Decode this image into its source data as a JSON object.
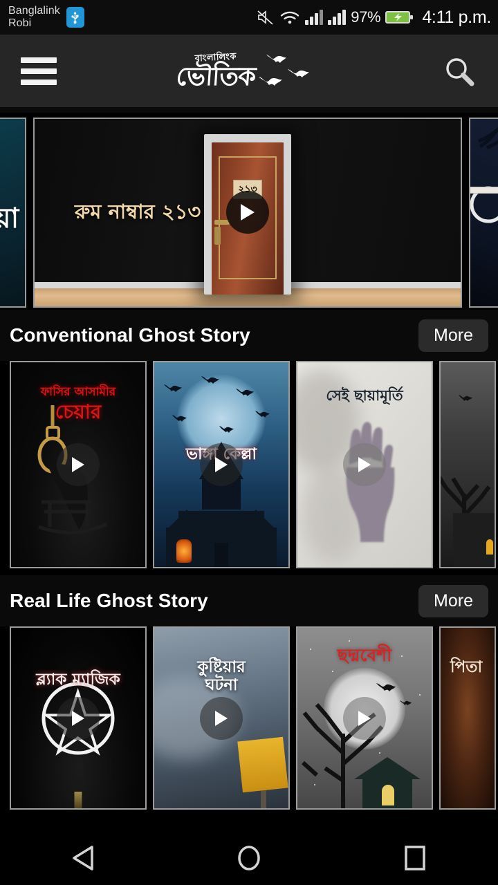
{
  "status_bar": {
    "carrier_1": "Banglalink",
    "carrier_2": "Robi",
    "usb_icon": "usb-icon",
    "mute_icon": "mute-icon",
    "wifi_icon": "wifi-icon",
    "signal_1_icon": "signal-bars-icon",
    "signal_2_icon": "signal-bars-icon",
    "battery_percent": "97%",
    "battery_icon": "battery-charging-icon",
    "clock": "4:11 p.m."
  },
  "app_bar": {
    "menu_icon": "hamburger-menu-icon",
    "logo_sub": "বাংলালিংক",
    "logo_main": "ভৌতিক",
    "bats_icon": "bats-icon",
    "search_icon": "search-icon"
  },
  "carousel": {
    "left_peek": {
      "title": "য়া",
      "bg": "#0d3b4a"
    },
    "featured": {
      "title": "রুম নাম্বার ২১৩",
      "door_number": "২১৩",
      "play_icon": "play-icon"
    },
    "right_peek": {
      "bg": "#141d33"
    }
  },
  "sections": [
    {
      "title": "Conventional Ghost Story",
      "more_label": "More",
      "cards": [
        {
          "title_line1": "ফাসির আসামীর",
          "title_line2": "চেয়ার",
          "art": "noose-chair",
          "play_icon": "play-icon"
        },
        {
          "title_line1": "",
          "title_line2": "ভাঙ্গা কেল্লা",
          "art": "haunted-castle",
          "play_icon": "play-icon"
        },
        {
          "title_line1": "",
          "title_line2": "সেই ছায়ামূর্তি",
          "art": "hand-glass",
          "play_icon": "play-icon"
        },
        {
          "title_line1": "",
          "title_line2": "",
          "art": "grey-tree-house",
          "play_icon": "play-icon"
        }
      ]
    },
    {
      "title": "Real Life Ghost Story",
      "more_label": "More",
      "cards": [
        {
          "title_line1": "",
          "title_line2": "ব্ল্যাক ম্যাজিক",
          "art": "pentagram",
          "play_icon": "play-icon"
        },
        {
          "title_line1": "কুষ্টিয়ার",
          "title_line2": "ঘটনা",
          "art": "fog-sign",
          "play_icon": "play-icon"
        },
        {
          "title_line1": "",
          "title_line2": "ছদ্মবেশী",
          "art": "moon-tree-hut",
          "play_icon": "play-icon"
        },
        {
          "title_line1": "",
          "title_line2": "পিতা",
          "art": "brown-fade",
          "play_icon": "play-icon"
        }
      ]
    }
  ],
  "nav_bar": {
    "back_icon": "back-triangle-icon",
    "home_icon": "home-circle-icon",
    "recents_icon": "recents-square-icon"
  },
  "colors": {
    "app_bar_bg": "#262626",
    "page_bg": "#000000",
    "more_button_bg": "#2b2b2b",
    "accent_gold": "#f3d9a8",
    "accent_red": "#d81414"
  }
}
